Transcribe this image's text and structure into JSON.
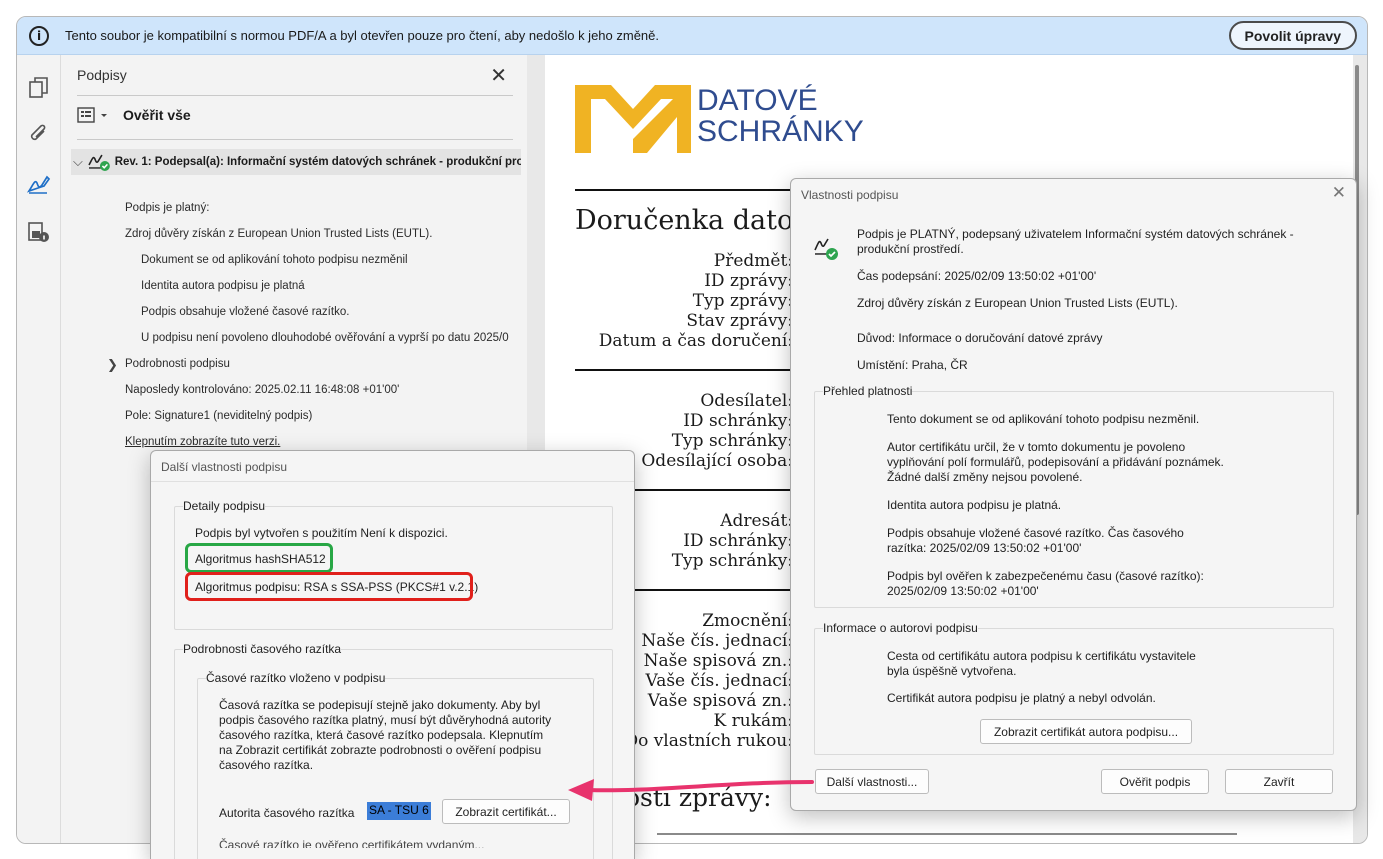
{
  "infobar": {
    "icon": "info-icon",
    "text": "Tento soubor je kompatibilní s normou PDF/A a byl otevřen pouze pro čtení, aby nedošlo k jeho změně.",
    "enable_button": "Povolit úpravy"
  },
  "rail": {
    "icons": [
      "pages-icon",
      "attachment-icon",
      "signature-icon",
      "security-icon"
    ]
  },
  "signatures_panel": {
    "title": "Podpisy",
    "verify_all": "Ověřit vše",
    "revision": "Rev. 1: Podepsal(a): Informační systém datových schránek - produkční pro",
    "lines": {
      "valid": "Podpis je platný:",
      "trust_source": "Zdroj důvěry získán z European Union Trusted Lists (EUTL).",
      "unchanged": "Dokument se od aplikování tohoto podpisu nezměnil",
      "identity": "Identita autora podpisu je platná",
      "timestamp": "Podpis obsahuje vložené časové razítko.",
      "ltv": "U podpisu není povoleno dlouhodobé ověřování a vyprší po datu 2025/0",
      "details": "Podrobnosti podpisu",
      "last_checked": "Naposledy kontrolováno: 2025.02.11 16:48:08 +01'00'",
      "field": "Pole: Signature1 (neviditelný podpis)",
      "click_link": "Klepnutím zobrazíte tuto verzi."
    }
  },
  "document": {
    "logo_line1": "DATOVÉ",
    "logo_line2": "SCHRÁNKY",
    "title": "Doručenka datov",
    "labels_1": [
      "Předmět:",
      "ID zprávy:",
      "Typ zprávy:",
      "Stav zprávy:",
      "Datum a čas doručení:"
    ],
    "labels_2": [
      "Odesílatel:",
      "ID schránky:",
      "Typ schránky:",
      "Odesílající osoba:"
    ],
    "labels_3": [
      "Adresát:",
      "ID schránky:",
      "Typ schránky:"
    ],
    "labels_4": [
      "Zmocnění:",
      "Naše čís. jednací:",
      "Naše spisová zn.:",
      "Vaše čís. jednací:",
      "Vaše spisová zn.:",
      "K rukám:",
      "Do vlastních rukou:"
    ],
    "bottom": "osti zprávy:"
  },
  "properties_dialog": {
    "title": "Vlastnosti podpisu",
    "status": "Podpis je PLATNÝ, podepsaný uživatelem Informační systém datových schránek - produkční prostředí.",
    "signed_time": "Čas podepsání:  2025/02/09 13:50:02 +01'00'",
    "trust_source": "Zdroj důvěry získán z European Union Trusted Lists (EUTL).",
    "reason": "Důvod:  Informace o doručování datové zprávy",
    "location": "Umístění:  Praha, ČR",
    "validity_title": "Přehled platnosti",
    "validity": [
      "Tento dokument se od aplikování tohoto podpisu nezměnil.",
      "Autor certifikátu určil, že v tomto dokumentu je povoleno vyplňování polí formulářů, podepisování a přidávání poznámek. Žádné další změny nejsou povolené.",
      "Identita autora podpisu je platná.",
      "Podpis obsahuje vložené časové razítko. Čas časového razítka: 2025/02/09 13:50:02 +01'00'",
      "Podpis byl ověřen k zabezpečenému času (časové razítko): 2025/02/09 13:50:02 +01'00'"
    ],
    "author_title": "Informace o autorovi podpisu",
    "author": [
      "Cesta od certifikátu autora podpisu k certifikátu vystavitele byla úspěšně vytvořena.",
      "Certifikát autora podpisu je platný a nebyl odvolán."
    ],
    "show_cert_button": "Zobrazit certifikát autora podpisu...",
    "more_button": "Další vlastnosti...",
    "verify_button": "Ověřit podpis",
    "close_button": "Zavřít"
  },
  "more_dialog": {
    "title": "Další vlastnosti podpisu",
    "details_title": "Detaily podpisu",
    "created_with": "Podpis byl vytvořen s použitím Není k dispozici.",
    "hash_algorithm": "Algoritmus hashSHA512",
    "sig_algorithm": "Algoritmus podpisu: RSA s SSA-PSS (PKCS#1 v.2.1)",
    "ts_title": "Podrobnosti časového razítka",
    "ts_embedded": "Časové razítko vloženo v podpisu",
    "ts_text": "Časová razítka se podepisují stejně jako dokumenty. Aby byl podpis časového razítka platný, musí být důvěryhodná autority časového razítka, která časové razítko podepsala. Klepnutím na Zobrazit certifikát zobrazte podrobnosti o ověření podpisu časového razítka.",
    "ts_authority_label": "Autorita časového razítka",
    "ts_authority_value": "SA - TSU 6",
    "show_cert_button": "Zobrazit certifikát...",
    "trailing": "Časové razítko je ověřeno certifikátem vydaným..."
  },
  "colors": {
    "highlight_green": "#28a745",
    "highlight_red": "#e0201b",
    "arrow": "#e8336d",
    "logo_blue": "#2f4c8f",
    "logo_yellow": "#f0b323"
  }
}
